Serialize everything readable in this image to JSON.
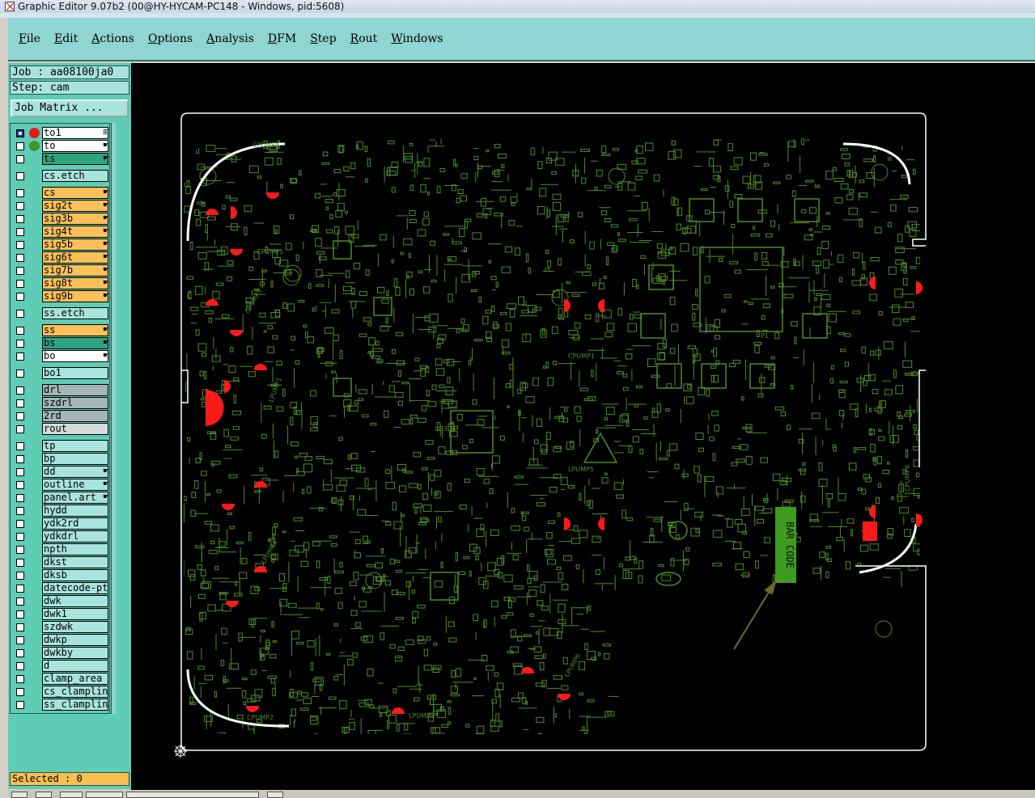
{
  "window": {
    "title": "Graphic Editor 9.07b2 (00@HY-HYCAM-PC148 - Windows, pid:5608)"
  },
  "menu": [
    "File",
    "Edit",
    "Actions",
    "Options",
    "Analysis",
    "DFM",
    "Step",
    "Rout",
    "Windows"
  ],
  "panel": {
    "job": "Job : aa08100ja0",
    "step": "Step: cam",
    "job_matrix_label": "Job Matrix ...",
    "selected": "Selected : 0"
  },
  "layers": [
    {
      "name": "to1",
      "color": "white",
      "dot": "#e21b1b",
      "checked": true,
      "indicator": "grid"
    },
    {
      "name": "to",
      "color": "white",
      "dot": "#3a9a2a",
      "checked": false,
      "indicator": "hand"
    },
    {
      "name": "ts",
      "color": "teal",
      "dot": "",
      "checked": false,
      "indicator": "hand"
    },
    {
      "name": "cs.etch",
      "color": "cyan",
      "dot": "",
      "checked": false,
      "indicator": ""
    },
    {
      "name": "cs",
      "color": "orange",
      "dot": "",
      "checked": false,
      "indicator": "hand"
    },
    {
      "name": "sig2t",
      "color": "orange",
      "dot": "",
      "checked": false,
      "indicator": "hand"
    },
    {
      "name": "sig3b",
      "color": "orange",
      "dot": "",
      "checked": false,
      "indicator": "hand"
    },
    {
      "name": "sig4t",
      "color": "orange",
      "dot": "",
      "checked": false,
      "indicator": "hand"
    },
    {
      "name": "sig5b",
      "color": "orange",
      "dot": "",
      "checked": false,
      "indicator": "hand"
    },
    {
      "name": "sig6t",
      "color": "orange",
      "dot": "",
      "checked": false,
      "indicator": "hand"
    },
    {
      "name": "sig7b",
      "color": "orange",
      "dot": "",
      "checked": false,
      "indicator": "hand"
    },
    {
      "name": "sig8t",
      "color": "orange",
      "dot": "",
      "checked": false,
      "indicator": "hand"
    },
    {
      "name": "sig9b",
      "color": "orange",
      "dot": "",
      "checked": false,
      "indicator": "hand"
    },
    {
      "name": "ss.etch",
      "color": "cyan",
      "dot": "",
      "checked": false,
      "indicator": ""
    },
    {
      "name": "ss",
      "color": "orange",
      "dot": "",
      "checked": false,
      "indicator": "hand"
    },
    {
      "name": "bs",
      "color": "teal",
      "dot": "",
      "checked": false,
      "indicator": "hand"
    },
    {
      "name": "bo",
      "color": "white",
      "dot": "",
      "checked": false,
      "indicator": "hand"
    },
    {
      "name": "bo1",
      "color": "cyan",
      "dot": "",
      "checked": false,
      "indicator": ""
    },
    {
      "name": "drl",
      "color": "gray",
      "dot": "",
      "checked": false,
      "indicator": ""
    },
    {
      "name": "szdrl",
      "color": "gray",
      "dot": "",
      "checked": false,
      "indicator": ""
    },
    {
      "name": "2rd",
      "color": "gray",
      "dot": "",
      "checked": false,
      "indicator": ""
    },
    {
      "name": "rout",
      "color": "lgray",
      "dot": "",
      "checked": false,
      "indicator": ""
    },
    {
      "name": "tp",
      "color": "cyan",
      "dot": "",
      "checked": false,
      "indicator": ""
    },
    {
      "name": "bp",
      "color": "cyan",
      "dot": "",
      "checked": false,
      "indicator": ""
    },
    {
      "name": "dd",
      "color": "cyan",
      "dot": "",
      "checked": false,
      "indicator": "hand"
    },
    {
      "name": "outline",
      "color": "cyan",
      "dot": "",
      "checked": false,
      "indicator": "hand"
    },
    {
      "name": "panel.art",
      "color": "cyan",
      "dot": "",
      "checked": false,
      "indicator": "hand"
    },
    {
      "name": "hydd",
      "color": "cyan",
      "dot": "",
      "checked": false,
      "indicator": ""
    },
    {
      "name": "ydk2rd",
      "color": "cyan",
      "dot": "",
      "checked": false,
      "indicator": ""
    },
    {
      "name": "ydkdrl",
      "color": "cyan",
      "dot": "",
      "checked": false,
      "indicator": ""
    },
    {
      "name": "npth",
      "color": "cyan",
      "dot": "",
      "checked": false,
      "indicator": ""
    },
    {
      "name": "dkst",
      "color": "cyan",
      "dot": "",
      "checked": false,
      "indicator": ""
    },
    {
      "name": "dksb",
      "color": "cyan",
      "dot": "",
      "checked": false,
      "indicator": ""
    },
    {
      "name": "datecode-pte",
      "color": "cyan",
      "dot": "",
      "checked": false,
      "indicator": ""
    },
    {
      "name": "dwk",
      "color": "cyan",
      "dot": "",
      "checked": false,
      "indicator": ""
    },
    {
      "name": "dwk1",
      "color": "cyan",
      "dot": "",
      "checked": false,
      "indicator": ""
    },
    {
      "name": "szdwk",
      "color": "cyan",
      "dot": "",
      "checked": false,
      "indicator": ""
    },
    {
      "name": "dwkp",
      "color": "cyan",
      "dot": "",
      "checked": false,
      "indicator": ""
    },
    {
      "name": "dwkby",
      "color": "cyan",
      "dot": "",
      "checked": false,
      "indicator": ""
    },
    {
      "name": "d",
      "color": "cyan",
      "dot": "",
      "checked": false,
      "indicator": ""
    },
    {
      "name": "clamp_area",
      "color": "cyan",
      "dot": "",
      "checked": false,
      "indicator": ""
    },
    {
      "name": "cs_clampline",
      "color": "cyan",
      "dot": "",
      "checked": false,
      "indicator": ""
    },
    {
      "name": "ss_clampline",
      "color": "cyan",
      "dot": "",
      "checked": false,
      "indicator": ""
    }
  ],
  "board": {
    "labels": [
      "CPUMP4",
      "CPUMP5",
      "CPUMP3",
      "LPUMP1",
      "LPUMP4",
      "CPUMP2",
      "LPUMP3",
      "CPUMP1",
      "LPUMP5",
      "LPUMP6",
      "CPUMP6",
      "U0304",
      "P1"
    ],
    "highlight_text": "BAR CODE",
    "trace_color": "#4f8a2c",
    "outline_color": "#ffffff",
    "marker_color": "#ff1a1a",
    "highlight_color": "#3f9a20"
  }
}
